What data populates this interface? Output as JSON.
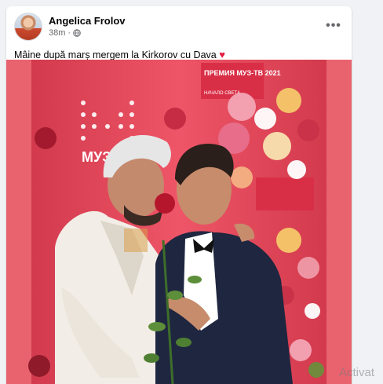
{
  "post": {
    "author": "Angelica Frolov",
    "time": "38m",
    "privacy_icon": "globe-icon",
    "more_icon": "more-options-icon",
    "more_label": "•••",
    "text": "Mâine după marș mergem la Kirkorov cu Dava",
    "emoji": "♥"
  },
  "photo": {
    "backdrop_text": "ПРЕМИЯ МУЗ-ТВ 2021",
    "backdrop_sub": "НАЧАЛО СВЕТА",
    "logo_text": "МУЗ"
  },
  "watermark": "Activat",
  "colors": {
    "backdrop": "#e5485a",
    "panel": "#e9636f",
    "like_heart": "#e41e3f"
  }
}
